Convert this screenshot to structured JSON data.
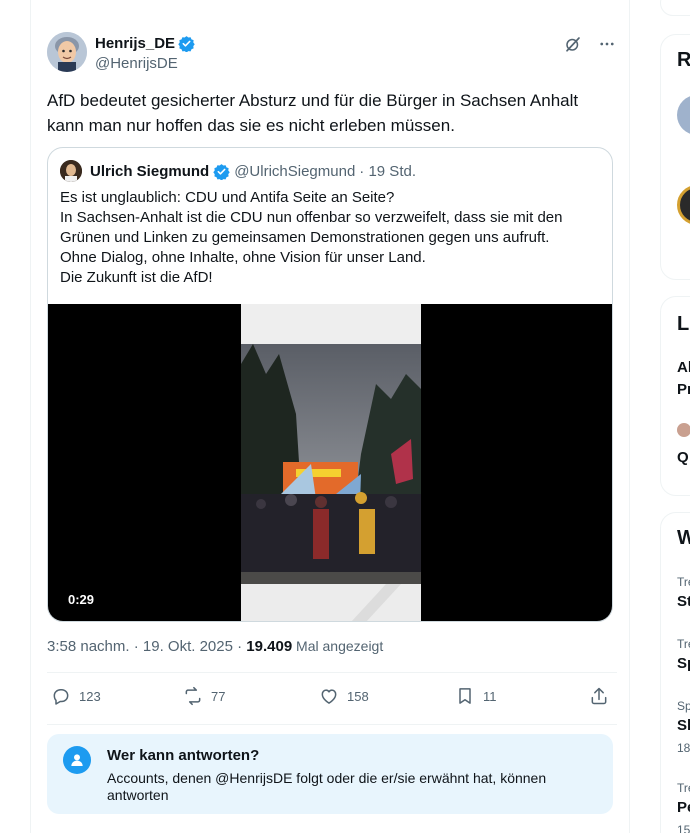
{
  "post": {
    "author_name": "Henrijs_DE",
    "author_handle": "@HenrijsDE",
    "text": "AfD bedeutet gesicherter Absturz und für die Bürger in Sachsen Anhalt kann man nur hoffen das sie es nicht erleben müssen.",
    "timestamp": "3:58 nachm. · 19. Okt. 2025 · ",
    "views_count": "19.409",
    "views_label": " Mal angezeigt"
  },
  "quote": {
    "author_name": "Ulrich Siegmund",
    "author_handle": "@UlrichSiegmund",
    "time": "· 19 Std.",
    "lines": [
      "Es ist unglaublich: CDU und Antifa Seite an Seite?",
      "In Sachsen-Anhalt ist die CDU nun offenbar so verzweifelt, dass sie mit den",
      "Grünen und Linken zu gemeinsamen Demonstrationen gegen uns aufruft.",
      "Ohne Dialog, ohne Inhalte, ohne Vision für unser Land.",
      "Die Zukunft ist die AfD!"
    ],
    "video_duration": "0:29"
  },
  "actions": {
    "replies": "123",
    "reposts": "77",
    "likes": "158",
    "bookmarks": "11"
  },
  "reply_restriction": {
    "title": "Wer kann antworten?",
    "description": "Accounts, denen @HenrijsDE folgt oder die er/sie erwähnt hat, können antworten"
  },
  "sidebar": {
    "card1_heading": "R",
    "card2_heading": "Li",
    "card2_item1_line1": "Al",
    "card2_item1_line2": "Pr",
    "card2_item2": "Q",
    "card3_heading": "W",
    "trends": [
      {
        "small": "Tre",
        "name": "St"
      },
      {
        "small": "Tre",
        "name": "Sp"
      },
      {
        "small": "Sp",
        "name": "Sl",
        "count": "18"
      },
      {
        "small": "Tre",
        "name": "Pe",
        "count": "15"
      }
    ]
  },
  "colors": {
    "accent": "#1d9bf0",
    "text_secondary": "#536471",
    "reply_box_bg": "#e8f5fd"
  },
  "icons": [
    "verified-badge-icon",
    "grok-icon",
    "more-icon",
    "reply-icon",
    "repost-icon",
    "like-icon",
    "bookmark-icon",
    "share-icon",
    "user-icon"
  ]
}
